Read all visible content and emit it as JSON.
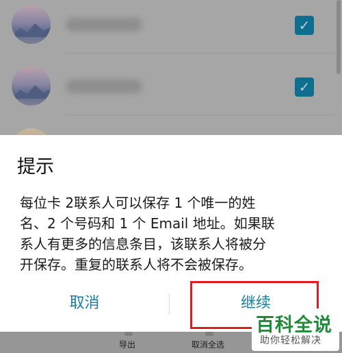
{
  "dialog": {
    "title": "提示",
    "message": "每位卡 2联系人可以保存 1 个唯一的姓\n名、2 个号码和 1 个 Email 地址。如果联\n系人有更多的信息条目，该联系人将被分\n开保存。重复的联系人将不会被保存。",
    "cancel_label": "取消",
    "continue_label": "继续"
  },
  "contacts": {
    "check_glyph": "✓"
  },
  "toolbar": {
    "export_label": "导出",
    "deselect_all_label": "取消全选"
  },
  "watermark": {
    "main": "百科全说",
    "sub": "助你轻松解决"
  },
  "colors": {
    "accent": "#1a7ca0",
    "checkbox": "#0e6e90",
    "highlight": "#e11b22",
    "watermark_green": "#1f8a3a"
  }
}
